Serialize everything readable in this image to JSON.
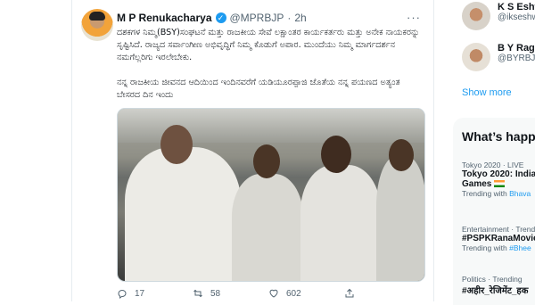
{
  "tweet": {
    "author_name": "M P Renukacharya",
    "handle": "@MPRBJP",
    "separator": "·",
    "time": "2h",
    "paragraph_1": "ದಶಕಗಳ ನಿಮ್ಮ(BSY)ಸಂಘಟನೆ ಮತ್ತು ರಾಜಕೀಯ ಸೇವೆ ಲಕ್ಷಾಂತರ ಕಾರ್ಯಕರ್ತರು ಮತ್ತು ಅನೇಕ ನಾಯಕರನ್ನು ಸೃಷ್ಟಿಸಿದೆ. ರಾಜ್ಯದ ಸರ್ವಾಂಗೀಣ ಅಭಿವೃದ್ಧಿಗೆ ನಿಮ್ಮ ಕೊಡುಗೆ ಅಪಾರ. ಮುಂದೆಯು ನಿಮ್ಮ ಮಾರ್ಗದರ್ಶನ ನಮಗೆಲ್ಲರಿಗು ಇರಲೇಬೇಕು.",
    "paragraph_2": "ನನ್ನ ರಾಜಕೀಯ ಜೀವನದ ಆದಿಯಿಂದ ಇಂದಿನವರೆಗೆ ಯಡಿಯೂರಪ್ಪಾಜಿ ಜೊತೆಯ ನನ್ನ ಪಯಣದ ಅತ್ಯಂತ ಬೇಸರದ ದಿನ ಇಂದು",
    "actions": {
      "replies": "17",
      "retweets": "58",
      "likes": "602"
    }
  },
  "sidebar": {
    "who_to_follow": [
      {
        "name": "K S Eshw",
        "handle": "@ikseshw"
      },
      {
        "name": "B Y Ragh",
        "handle": "@BYRBJP"
      }
    ],
    "show_more": "Show more",
    "trends_title": "What’s happ",
    "trends": [
      {
        "meta": "Tokyo 2020 · LIVE",
        "name": "Tokyo 2020: India",
        "name_2": "Games",
        "sub_label": "Trending with",
        "sub_link": "Bhava"
      },
      {
        "meta": "Entertainment · Trending",
        "name": "#PSPKRanaMovie",
        "sub_label": "Trending with",
        "sub_link": "#Bhee"
      },
      {
        "meta": "Politics · Trending",
        "name": "#अहीर_रेजिमेंट_हक"
      }
    ]
  },
  "colors": {
    "accent": "#1d9bf0",
    "text_secondary": "#536471",
    "border": "#e6ecf0"
  }
}
